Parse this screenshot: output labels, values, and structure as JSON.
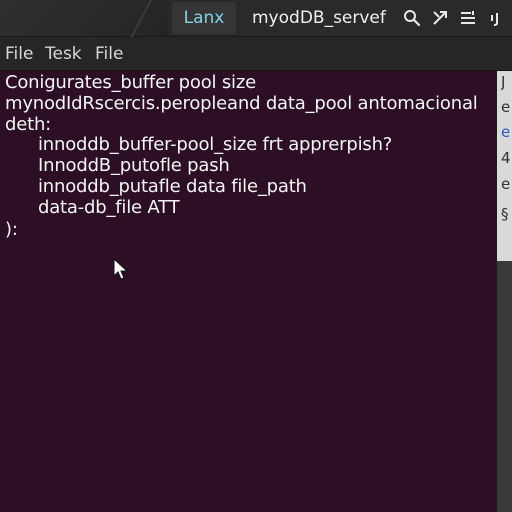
{
  "titlebar": {
    "tabs": [
      {
        "label": "Lanx"
      },
      {
        "label": "myodDB_servef"
      }
    ],
    "icons": [
      "search-icon",
      "resize-icon",
      "menu-list-icon",
      "close-icon"
    ]
  },
  "menubar": {
    "items": [
      "File",
      "Tesk",
      "File"
    ]
  },
  "terminal": {
    "lines": [
      "Conigurates_buffer pool size",
      "mynodIdRscercis.peropleand data_pool antomacional",
      "deth:",
      "innoddb_buffer-pool_size frt apprerpish?",
      "InnoddB_putofle pash",
      "innoddb_putafle data file_path",
      "data-db_file ATT",
      "):"
    ]
  },
  "side_panel": {
    "glyphs": [
      "J",
      "e",
      "e",
      "4",
      "e",
      "§"
    ]
  },
  "colors": {
    "terminal_bg": "#2c0f24",
    "active_tab_text": "#7fd3e6",
    "titlebar_bg": "#2a2a2a",
    "menubar_bg": "#262626"
  }
}
